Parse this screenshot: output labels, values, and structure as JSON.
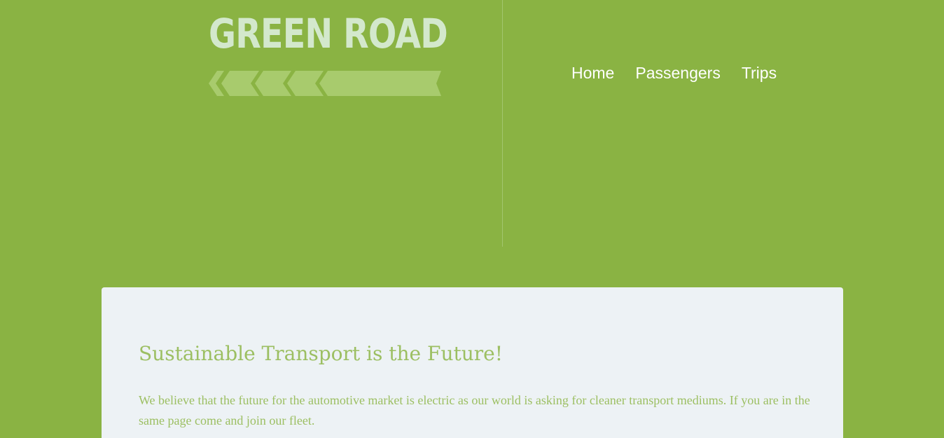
{
  "brand": {
    "title": "GREEN ROAD",
    "road_icon": "road-arrows-icon"
  },
  "nav": {
    "items": [
      {
        "label": "Home"
      },
      {
        "label": "Passengers"
      },
      {
        "label": "Trips"
      }
    ]
  },
  "hero": {
    "heading": "Sustainable Transport is the Future!",
    "text": "We believe that the future for the automotive market is electric as our world is asking for cleaner transport mediums. If you are in the same page come and join our fleet."
  },
  "colors": {
    "background": "#8ab343",
    "brand_text": "#d3e8cc",
    "card_background": "#edf2f5",
    "card_text": "#9cbf62",
    "nav_text": "#ffffff"
  }
}
